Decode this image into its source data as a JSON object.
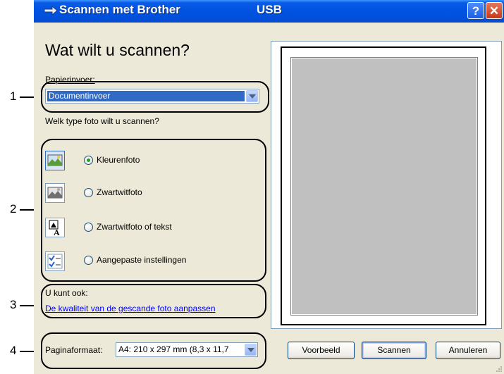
{
  "window": {
    "title": "Scannen met Brother",
    "connection": "USB",
    "help_label": "?",
    "close_label": "✕"
  },
  "main": {
    "heading": "Wat wilt u scannen?",
    "paper_feed_label": "Papierinvoer:",
    "paper_feed_value": "Documentinvoer",
    "photo_type_question": "Welk type foto wilt u scannen?",
    "options": [
      {
        "label": "Kleurenfoto",
        "selected": true,
        "icon": "color-photo-icon"
      },
      {
        "label": "Zwartwitfoto",
        "selected": false,
        "icon": "grayscale-photo-icon"
      },
      {
        "label": "Zwartwitfoto of tekst",
        "selected": false,
        "icon": "bw-text-icon"
      },
      {
        "label": "Aangepaste instellingen",
        "selected": false,
        "icon": "custom-settings-icon"
      }
    ],
    "also_label": "U kunt ook:",
    "quality_link": "De kwaliteit van de gescande foto aanpassen",
    "page_size_label": "Paginaformaat:",
    "page_size_value": "A4: 210 x 297 mm (8,3 x 11,7"
  },
  "buttons": {
    "preview": "Voorbeeld",
    "scan": "Scannen",
    "cancel": "Annuleren"
  },
  "callouts": [
    "1",
    "2",
    "3",
    "4"
  ],
  "colors": {
    "titlebar": "#0053e1",
    "dialog_bg": "#ece9d8",
    "selection": "#316ac5",
    "link": "#0000ff",
    "preview_page": "#c0c0c0"
  }
}
